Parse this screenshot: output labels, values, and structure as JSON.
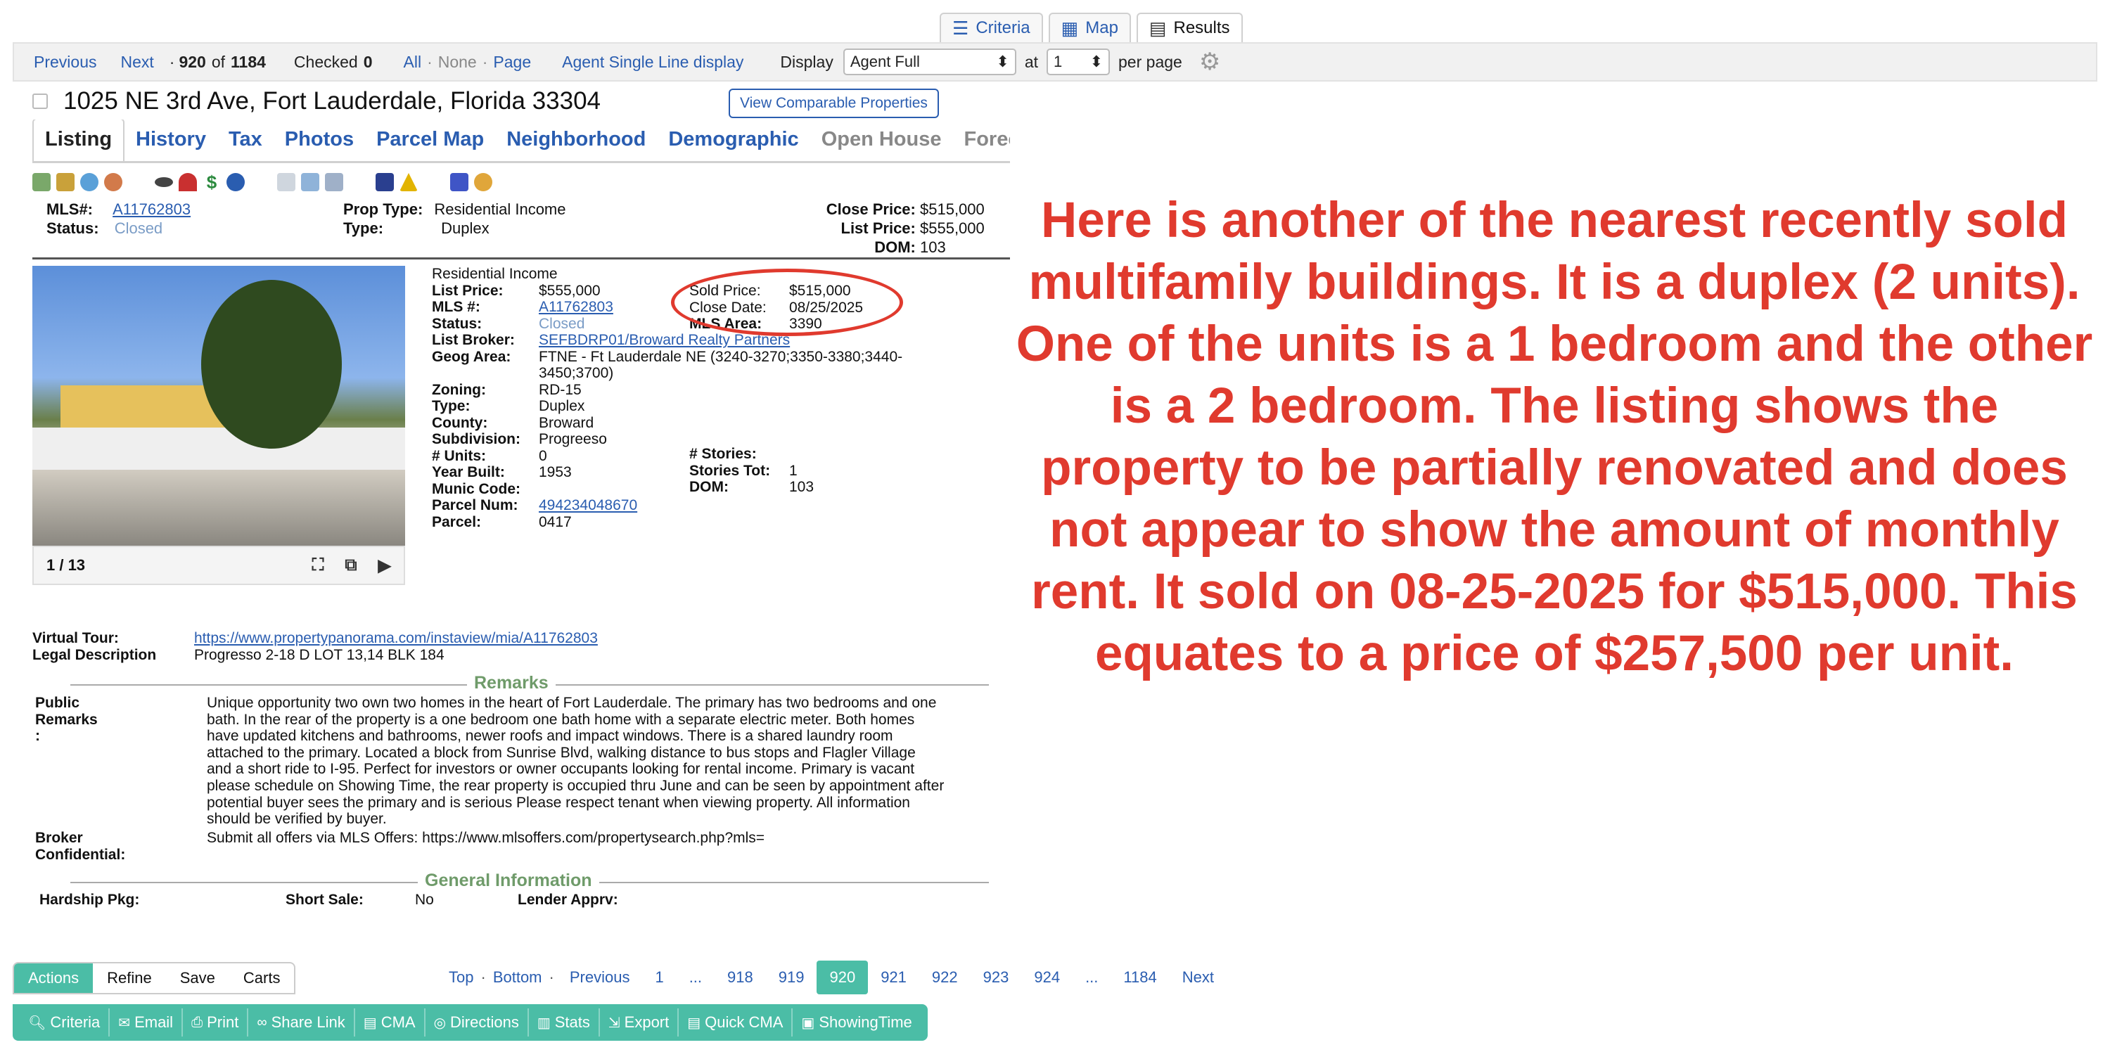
{
  "top_tabs": [
    {
      "label": "Criteria",
      "icon": "sliders-icon"
    },
    {
      "label": "Map",
      "icon": "map-icon"
    },
    {
      "label": "Results",
      "icon": "table-icon"
    }
  ],
  "navbar": {
    "previous": "Previous",
    "next": "Next",
    "position_prefix": "·",
    "position_current": "920",
    "position_of": "of",
    "position_total": "1184",
    "checked_label": "Checked",
    "checked_count": "0",
    "select_all": "All",
    "sep": "·",
    "select_none": "None",
    "select_page": "Page",
    "agent_single_line": "Agent Single Line display",
    "display_label": "Display",
    "display_value": "Agent Full",
    "at_label": "at",
    "per_page_value": "1",
    "per_page_label": "per page"
  },
  "listing": {
    "address": "1025 NE 3rd Ave, Fort Lauderdale, Florida 33304",
    "comparable_button": "View Comparable Properties",
    "tabs": [
      "Listing",
      "History",
      "Tax",
      "Photos",
      "Parcel Map",
      "Neighborhood",
      "Demographic",
      "Open House",
      "Foreclo"
    ],
    "summary": {
      "mls_label": "MLS#:",
      "mls_value": "A11762803",
      "status_label": "Status:",
      "status_value": "Closed",
      "prop_type_label": "Prop Type:",
      "prop_type_value": "Residential Income",
      "type_label": "Type:",
      "type_value": "Duplex",
      "close_price_label": "Close Price:",
      "close_price_value": "$515,000",
      "list_price_label": "List Price:",
      "list_price_value": "$555,000",
      "dom_label": "DOM:",
      "dom_value": "103"
    },
    "photo_counter": "1 / 13",
    "details": {
      "heading": "Residential Income",
      "rows": [
        {
          "label": "List Price:",
          "value": "$555,000"
        },
        {
          "label": "MLS #:",
          "value": "A11762803"
        },
        {
          "label": "Status:",
          "value": "Closed"
        },
        {
          "label": "List Broker:",
          "value": "SEFBDRP01/Broward Realty Partners"
        },
        {
          "label": "Geog Area:",
          "value": "FTNE - Ft Lauderdale NE (3240-3270;3350-3380;3440-"
        },
        {
          "label": "",
          "value": "3450;3700)"
        },
        {
          "label": "Zoning:",
          "value": "RD-15"
        },
        {
          "label": "Type:",
          "value": "Duplex"
        },
        {
          "label": "County:",
          "value": "Broward"
        },
        {
          "label": "Subdivision:",
          "value": "Progreeso"
        },
        {
          "label": "# Units:",
          "value": "0"
        },
        {
          "label": "Year Built:",
          "value": "1953"
        },
        {
          "label": "Munic Code:",
          "value": ""
        },
        {
          "label": "Parcel Num:",
          "value": "494234048670"
        },
        {
          "label": "Parcel:",
          "value": "0417"
        }
      ],
      "sold": [
        {
          "label": "Sold Price:",
          "value": "$515,000"
        },
        {
          "label": "Close Date:",
          "value": "08/25/2025"
        },
        {
          "label": "MLS Area:",
          "value": "3390"
        }
      ],
      "stories": [
        {
          "label": "# Stories:",
          "value": ""
        },
        {
          "label": "Stories Tot:",
          "value": "1"
        },
        {
          "label": "DOM:",
          "value": "103"
        }
      ]
    },
    "virtual_tour_label": "Virtual Tour:",
    "virtual_tour_value": "https://www.propertypanorama.com/instaview/mia/A11762803",
    "legal_label": "Legal Description",
    "legal_value": "Progresso 2-18 D LOT 13,14 BLK 184",
    "remarks_title": "Remarks",
    "public_remarks_label": "Public Remarks :",
    "public_remarks_lines": [
      "Unique opportunity two own two homes in the heart of Fort Lauderdale. The primary has two bedrooms and one",
      "bath. In the rear of the property is a one bedroom one bath home with a separate electric meter. Both homes",
      "have updated kitchens and bathrooms, newer roofs and impact windows. There is a shared laundry room",
      "attached to the primary. Located a block from Sunrise Blvd, walking distance to bus stops and Flagler Village",
      "and a short ride to I-95. Perfect for investors or owner occupants looking for rental income. Primary is vacant",
      "please schedule on Showing Time, the rear property is occupied thru June and can be seen by appointment after",
      "potential buyer sees the primary and is serious Please respect tenant when viewing property. All information",
      "should be verified by buyer."
    ],
    "broker_conf_label": "Broker Confidential:",
    "broker_conf_value": "Submit all offers via MLS Offers: https://www.mlsoffers.com/propertysearch.php?mls=",
    "general_title": "General Information",
    "hardship_label": "Hardship Pkg:",
    "short_sale_label": "Short Sale:",
    "short_sale_value": "No",
    "lender_label": "Lender Apprv:"
  },
  "actions": {
    "tabs": [
      "Actions",
      "Refine",
      "Save",
      "Carts"
    ],
    "buttons": [
      {
        "label": "Criteria",
        "icon": "search-icon"
      },
      {
        "label": "Email",
        "icon": "email-icon"
      },
      {
        "label": "Print",
        "icon": "print-icon"
      },
      {
        "label": "Share Link",
        "icon": "link-icon"
      },
      {
        "label": "CMA",
        "icon": "document-icon"
      },
      {
        "label": "Directions",
        "icon": "compass-icon"
      },
      {
        "label": "Stats",
        "icon": "bar-chart-icon"
      },
      {
        "label": "Export",
        "icon": "export-icon"
      },
      {
        "label": "Quick CMA",
        "icon": "document-icon"
      },
      {
        "label": "ShowingTime",
        "icon": "calendar-icon"
      }
    ]
  },
  "pager": {
    "top": "Top",
    "bottom": "Bottom",
    "dot": "·",
    "previous": "Previous",
    "pages": [
      "1",
      "...",
      "918",
      "919",
      "920",
      "921",
      "922",
      "923",
      "924",
      "...",
      "1184"
    ],
    "current": "920",
    "next": "Next"
  },
  "annotation": {
    "text": "Here is another of the nearest recently sold multifamily buildings. It is a duplex (2 units). One of the units is a 1 bedroom and the other is a 2 bedroom. The listing shows the property to be partially renovated and does not appear to show the amount of monthly rent. It sold on 08-25-2025 for $515,000. This equates to a price of $257,500 per unit.",
    "color": "#e03a2e"
  },
  "colors": {
    "accent": "#4bbda6",
    "link": "#2a5db0",
    "section": "#6f9b6a"
  }
}
